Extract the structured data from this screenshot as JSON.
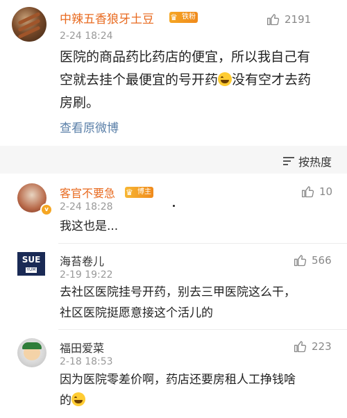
{
  "main_post": {
    "author": "中辣五香狼牙土豆",
    "badge": "铁粉",
    "time": "2-24 18:24",
    "likes": "2191",
    "content_parts": [
      "医院的商品药比药店的便宜，所以我自己有",
      "空就去挂个最便宜的号开药",
      "没有空才去药",
      "房刷。"
    ],
    "view_original": "查看原微博"
  },
  "sort": {
    "label": "按热度"
  },
  "comments": [
    {
      "author": "客官不要急",
      "badge": "博主",
      "time": "2-24 18:28",
      "likes": "10",
      "content": "我这也是..."
    },
    {
      "author": "海苔卷儿",
      "avatar_text": "SUE",
      "avatar_sub": "YUM",
      "time": "2-19 19:22",
      "likes": "566",
      "content_lines": [
        "去社区医院挂号开药，别去三甲医院这么干，",
        "社区医院挺愿意接这个活儿的"
      ]
    },
    {
      "author": "福田爱菜",
      "time": "2-18 18:53",
      "likes": "223",
      "content_lines": [
        "因为医院零差价啊，药店还要房租人工挣钱啥",
        "的"
      ]
    }
  ],
  "colors": {
    "name_orange": "#e86a1f",
    "link_blue": "#5a7fa8",
    "badge_orange": "#f5a623"
  }
}
